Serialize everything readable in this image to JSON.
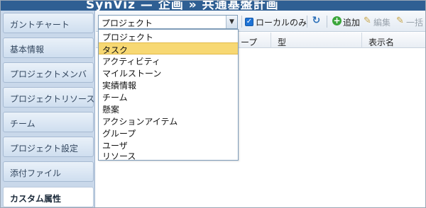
{
  "title_bar": {
    "text": "SynViz — 企画 » 共通基盤計画"
  },
  "sidebar": {
    "items": [
      {
        "label": "ガントチャート",
        "active": false
      },
      {
        "label": "基本情報",
        "active": false
      },
      {
        "label": "プロジェクトメンバ",
        "active": false
      },
      {
        "label": "プロジェクトリソース",
        "active": false
      },
      {
        "label": "チーム",
        "active": false
      },
      {
        "label": "プロジェクト設定",
        "active": false
      },
      {
        "label": "添付ファイル",
        "active": false
      },
      {
        "label": "カスタム属性",
        "active": true
      }
    ]
  },
  "toolbar": {
    "type_select": {
      "selected": "プロジェクト"
    },
    "local_only": {
      "label": "ローカルのみ",
      "checked": true
    },
    "refresh_icon": "refresh-icon",
    "add_label": "追加",
    "edit_label": "編集",
    "bulk_label": "一括"
  },
  "grid": {
    "columns": [
      "ープ",
      "型",
      "表示名"
    ]
  },
  "dropdown": {
    "highlighted_index": 1,
    "options": [
      "プロジェクト",
      "タスク",
      "アクティビティ",
      "マイルストーン",
      "実績情報",
      "チーム",
      "懸案",
      "アクションアイテム",
      "グループ",
      "ユーザ",
      "リソース"
    ]
  },
  "colors": {
    "accent": "#2f5f93",
    "highlight": "#f7d873",
    "sidebar_bg": "#c9d8ea"
  }
}
